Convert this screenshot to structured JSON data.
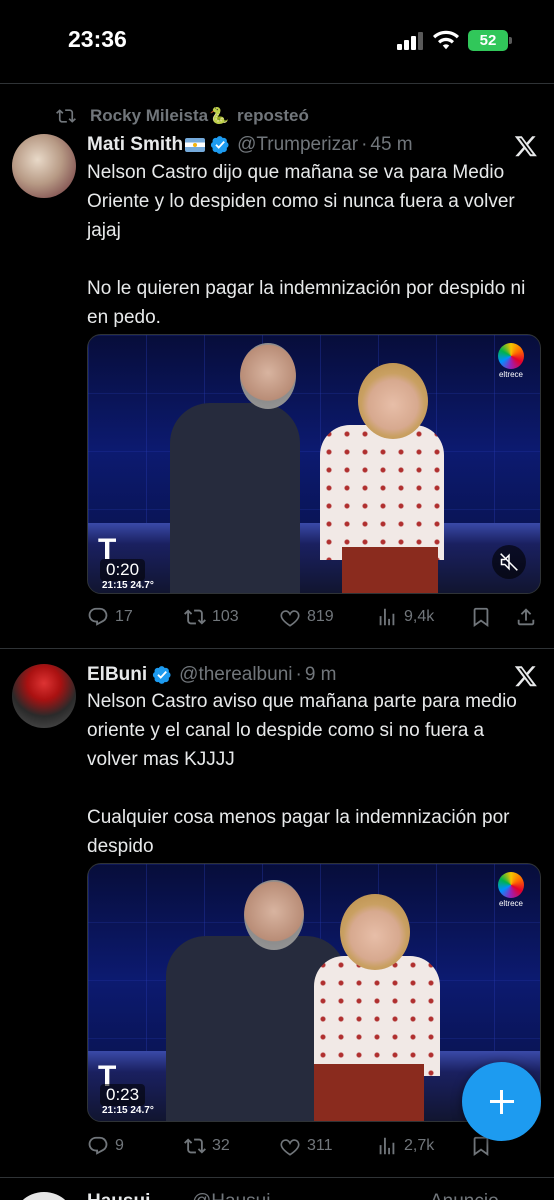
{
  "status_bar": {
    "time": "23:36",
    "battery": "52"
  },
  "tweets": [
    {
      "reposted_by": "Rocky Mileista",
      "reposted_emoji": "🐍",
      "reposted_suffix": "reposteó",
      "name": "Mati Smith",
      "handle": "@Trumperizar",
      "dot": "·",
      "time": "45 m",
      "paragraphs": [
        "Nelson Castro dijo que mañana se va para Medio Oriente y lo despiden como si nunca fuera a volver jajaj",
        "No le quieren pagar la indemnización por despido ni en pedo."
      ],
      "media": {
        "duration": "0:20",
        "overlay_time": "21:15 24.7°",
        "channel": "eltrece",
        "tn": "T"
      },
      "stats": {
        "replies": "17",
        "reposts": "103",
        "likes": "819",
        "views": "9,4k"
      }
    },
    {
      "name": "ElBuni",
      "handle": "@therealbuni",
      "dot": "·",
      "time": "9 m",
      "paragraphs": [
        "Nelson Castro aviso que mañana parte para medio oriente y el canal lo despide como si no fuera a volver mas KJJJJ",
        "Cualquier cosa menos pagar la indemnización por despido"
      ],
      "media": {
        "duration": "0:23",
        "overlay_time": "21:15 24.7°",
        "channel": "eltrece",
        "tn": "T"
      },
      "stats": {
        "replies": "9",
        "reposts": "32",
        "likes": "311",
        "views": "2,7k"
      }
    }
  ],
  "next_peek": {
    "name": "Hausui",
    "handle": "@Hausui",
    "label": "Anuncio"
  },
  "icons": {
    "repost": "repost-icon",
    "verified": "verified-badge-icon",
    "x_logo": "x-logo-icon",
    "reply": "reply-icon",
    "like": "heart-icon",
    "views": "views-icon",
    "bookmark": "bookmark-icon",
    "share": "share-icon",
    "mute": "muted-speaker-icon",
    "compose": "plus-icon"
  },
  "colors": {
    "accent": "#1d9bf0",
    "background": "#000000",
    "muted_text": "#71767b",
    "battery": "#31c75a"
  }
}
